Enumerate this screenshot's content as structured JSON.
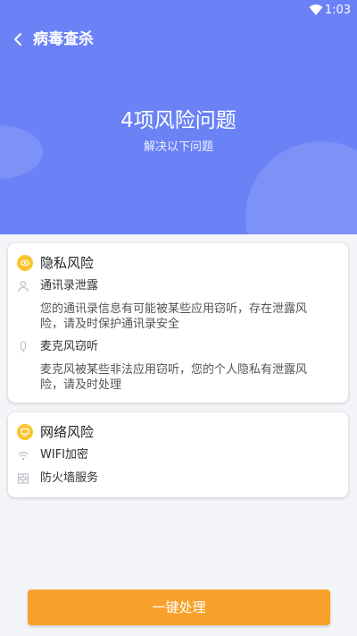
{
  "status_bar": {
    "time": "1:03",
    "wifi_icon": "wifi-icon"
  },
  "header": {
    "back_icon": "chevron-left-icon",
    "title": "病毒查杀"
  },
  "summary": {
    "headline": "4项风险问题",
    "subtitle": "解决以下问题"
  },
  "cards": [
    {
      "icon": "eye-icon",
      "title": "隐私风险",
      "items": [
        {
          "icon": "person-icon",
          "label": "通讯录泄露",
          "description": "您的通讯录信息有可能被某些应用窃听，存在泄露风险，请及时保护通讯录安全"
        },
        {
          "icon": "microphone-icon",
          "label": "麦克风窃听",
          "description": "麦克风被某些非法应用窃听，您的个人隐私有泄露风险，请及时处理"
        }
      ]
    },
    {
      "icon": "monitor-icon",
      "title": "网络风险",
      "items": [
        {
          "icon": "wifi-icon",
          "label": "WIFI加密"
        },
        {
          "icon": "firewall-icon",
          "label": "防火墙服务"
        }
      ]
    }
  ],
  "action": {
    "label": "一键处理"
  },
  "colors": {
    "header_bg": "#6a82f6",
    "badge": "#f8c52c",
    "button": "#f8a12a",
    "page_bg": "#f4f5f9"
  }
}
